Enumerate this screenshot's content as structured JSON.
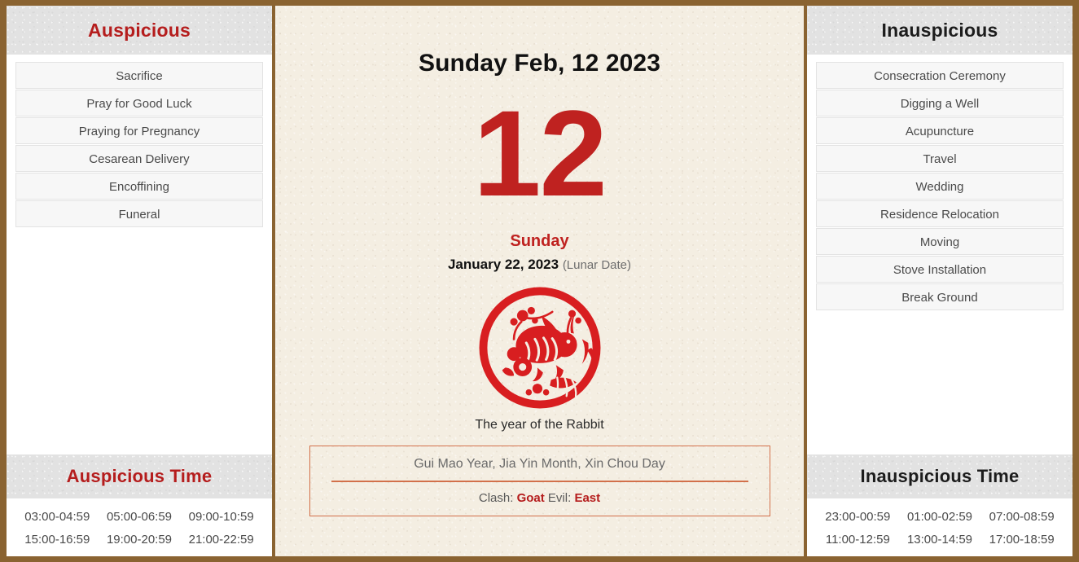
{
  "frame": {
    "border_color": "#8a6331",
    "accent_red": "#bf2220",
    "header_red": "#b51d1d",
    "paper_cream": "#f4eee2",
    "box_orange": "#d2704a"
  },
  "left_panel": {
    "header": "Auspicious",
    "items": [
      "Sacrifice",
      "Pray for Good Luck",
      "Praying for Pregnancy",
      "Cesarean Delivery",
      "Encoffining",
      "Funeral"
    ],
    "time_header": "Auspicious Time",
    "times": [
      "03:00-04:59",
      "05:00-06:59",
      "09:00-10:59",
      "15:00-16:59",
      "19:00-20:59",
      "21:00-22:59"
    ]
  },
  "right_panel": {
    "header": "Inauspicious",
    "items": [
      "Consecration Ceremony",
      "Digging a Well",
      "Acupuncture",
      "Travel",
      "Wedding",
      "Residence Relocation",
      "Moving",
      "Stove Installation",
      "Break Ground"
    ],
    "time_header": "Inauspicious Time",
    "times": [
      "23:00-00:59",
      "01:00-02:59",
      "07:00-08:59",
      "11:00-12:59",
      "13:00-14:59",
      "17:00-18:59"
    ]
  },
  "center": {
    "title": "Sunday Feb, 12 2023",
    "day_number": "12",
    "weekday": "Sunday",
    "lunar_date": "January 22, 2023",
    "lunar_note": "(Lunar Date)",
    "zodiac_icon": "rabbit-papercut-icon",
    "zodiac_caption": "The year of the Rabbit",
    "pillars": "Gui Mao Year, Jia Yin Month, Xin Chou Day",
    "clash_label": "Clash:",
    "clash_value": "Goat",
    "evil_label": "Evil:",
    "evil_value": "East"
  }
}
